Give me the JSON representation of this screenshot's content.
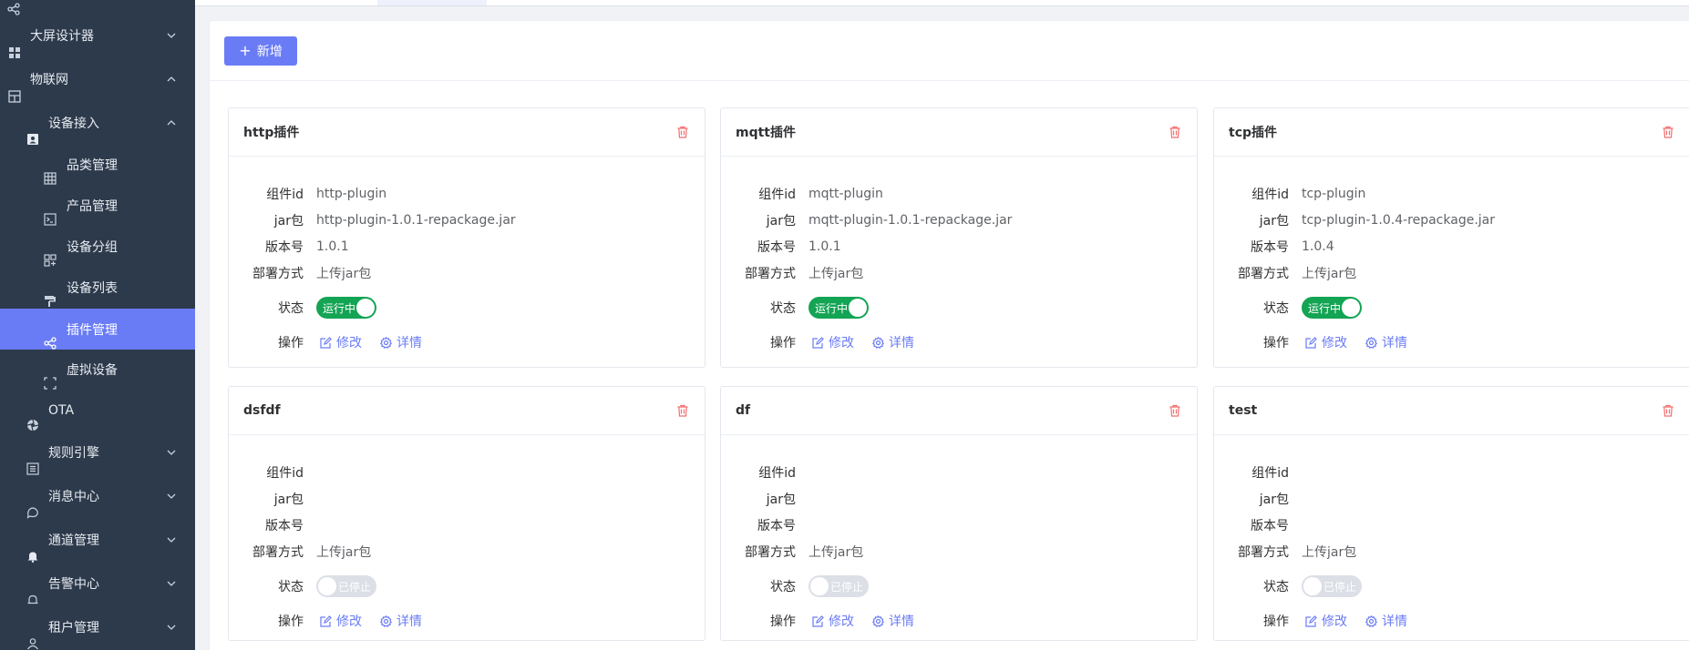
{
  "sidebar": {
    "items": [
      {
        "label": "",
        "icon": "share-nodes-icon"
      },
      {
        "label": "大屏设计器",
        "icon": "grid-icon",
        "expandable": true,
        "expanded": false
      },
      {
        "label": "物联网",
        "icon": "dashboard-icon",
        "expandable": true,
        "expanded": true
      },
      {
        "label": "设备接入",
        "icon": "user-card-icon",
        "expandable": true,
        "expanded": true
      },
      {
        "label": "品类管理",
        "icon": "table-icon"
      },
      {
        "label": "产品管理",
        "icon": "terminal-icon"
      },
      {
        "label": "设备分组",
        "icon": "group-icon"
      },
      {
        "label": "设备列表",
        "icon": "roller-icon"
      },
      {
        "label": "插件管理",
        "icon": "share-nodes-icon",
        "active": true
      },
      {
        "label": "虚拟设备",
        "icon": "fullscreen-icon"
      },
      {
        "label": "OTA",
        "icon": "aperture-icon"
      },
      {
        "label": "规则引擎",
        "icon": "list-icon",
        "expandable": true,
        "expanded": false
      },
      {
        "label": "消息中心",
        "icon": "chat-icon",
        "expandable": true,
        "expanded": false
      },
      {
        "label": "通道管理",
        "icon": "bell-filled-icon",
        "expandable": true,
        "expanded": false
      },
      {
        "label": "告警中心",
        "icon": "bell-icon",
        "expandable": true,
        "expanded": false
      },
      {
        "label": "租户管理",
        "icon": "person-icon",
        "expandable": true,
        "expanded": false
      }
    ]
  },
  "toolbar": {
    "add_label": "新增"
  },
  "labels": {
    "component_id": "组件id",
    "jar": "jar包",
    "version": "版本号",
    "deploy": "部署方式",
    "status": "状态",
    "actions": "操作",
    "edit": "修改",
    "detail": "详情"
  },
  "cards": [
    {
      "title": "http插件",
      "component_id": "http-plugin",
      "jar": "http-plugin-1.0.1-repackage.jar",
      "version": "1.0.1",
      "deploy": "上传jar包",
      "status": "运行中",
      "running": true
    },
    {
      "title": "mqtt插件",
      "component_id": "mqtt-plugin",
      "jar": "mqtt-plugin-1.0.1-repackage.jar",
      "version": "1.0.1",
      "deploy": "上传jar包",
      "status": "运行中",
      "running": true
    },
    {
      "title": "tcp插件",
      "component_id": "tcp-plugin",
      "jar": "tcp-plugin-1.0.4-repackage.jar",
      "version": "1.0.4",
      "deploy": "上传jar包",
      "status": "运行中",
      "running": true
    },
    {
      "title": "dsfdf",
      "component_id": "",
      "jar": "",
      "version": "",
      "deploy": "上传jar包",
      "status": "已停止",
      "running": false
    },
    {
      "title": "df",
      "component_id": "",
      "jar": "",
      "version": "",
      "deploy": "上传jar包",
      "status": "已停止",
      "running": false
    },
    {
      "title": "test",
      "component_id": "",
      "jar": "",
      "version": "",
      "deploy": "上传jar包",
      "status": "已停止",
      "running": false
    }
  ],
  "colors": {
    "sidebar_bg": "#2d3a4b",
    "accent": "#6a7cf5",
    "running": "#13a454",
    "stopped": "#dcdfe6",
    "delete": "#f56c6c"
  }
}
